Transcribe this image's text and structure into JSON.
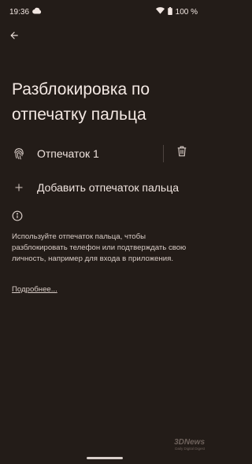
{
  "status": {
    "time": "19:36",
    "battery": "100 %"
  },
  "header": {
    "title": "Разблокировка по отпечатку пальца"
  },
  "fingerprints": [
    {
      "label": "Отпечаток 1"
    }
  ],
  "add": {
    "label": "Добавить отпечаток пальца"
  },
  "info": {
    "text": "Используйте отпечаток пальца, чтобы разблокировать телефон или подтверждать свою личность, например для входа в приложения.",
    "link": "Подробнее..."
  },
  "watermark": {
    "logo": "3DNews",
    "tagline": "Daily Digital Digest"
  },
  "icons": [
    "cloud-icon",
    "wifi-icon",
    "battery-icon",
    "back-arrow-icon",
    "fingerprint-icon",
    "trash-icon",
    "plus-icon",
    "info-icon"
  ]
}
